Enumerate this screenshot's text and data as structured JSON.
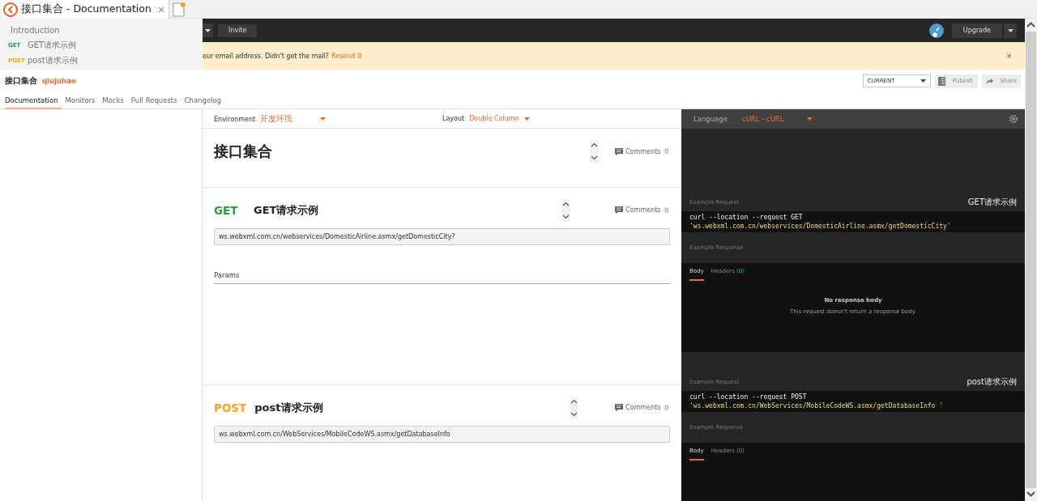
{
  "browser_tab": {
    "title": "接口集合 - Documentation",
    "close": "×"
  },
  "sidebar": {
    "items": [
      {
        "kind": "heading",
        "label": "Introduction"
      },
      {
        "kind": "request",
        "method": "GET",
        "label": "GET请求示例"
      },
      {
        "kind": "request",
        "method": "POST",
        "label": "post请求示例"
      }
    ]
  },
  "app_bar": {
    "invite": "Invite",
    "upgrade": "Upgrade"
  },
  "banner": {
    "text": "our email address. Didn't get the mail?",
    "link": "Resend it",
    "close": "×"
  },
  "collection": {
    "name": "接口集合",
    "owner": "qiujuhao",
    "version": "CURRENT",
    "publish": "Publish",
    "share": "Share"
  },
  "tabs": [
    {
      "label": "Documentation",
      "selected": true
    },
    {
      "label": "Monitors",
      "selected": false
    },
    {
      "label": "Mocks",
      "selected": false
    },
    {
      "label": "Pull Requests",
      "selected": false
    },
    {
      "label": "Changelog",
      "selected": false
    }
  ],
  "environment": {
    "label": "Environment",
    "value": "开发环境"
  },
  "layout": {
    "label": "Layout",
    "value": "Double Column"
  },
  "language": {
    "label": "Language",
    "value": "cURL - cURL"
  },
  "intro": {
    "title": "接口集合",
    "comments": "Comments",
    "count": "0"
  },
  "requests": [
    {
      "method": "GET",
      "name": "GET请求示例",
      "url": "ws.webxml.com.cn/webservices/DomesticAirline.asmx/getDomesticCity?",
      "comments": "Comments",
      "count": "0",
      "params": "Params",
      "example_request_label": "Example Request",
      "example_name": "GET请求示例",
      "curl_command": "curl --location --request GET",
      "curl_url": "'ws.webxml.com.cn/webservices/DomesticAirline.asmx/getDomesticCity'",
      "example_response_label": "Example Response",
      "response_tabs": [
        {
          "label": "Body",
          "selected": true
        },
        {
          "label": "Headers",
          "count": "(0)",
          "selected": false
        }
      ],
      "empty_title": "No response body",
      "empty_text": "This request doesn't return a response body."
    },
    {
      "method": "POST",
      "name": "post请求示例",
      "url": "ws.webxml.com.cn/WebServices/MobileCodeWS.asmx/getDatabaseInfo",
      "comments": "Comments",
      "count": "0",
      "example_request_label": "Example Request",
      "example_name": "post请求示例",
      "curl_command": "curl --location --request POST",
      "curl_url": "'ws.webxml.com.cn/WebServices/MobileCodeWS.asmx/getDatabaseInfo '",
      "example_response_label": "Example Response",
      "response_tabs": [
        {
          "label": "Body",
          "selected": true
        },
        {
          "label": "Headers",
          "count": "(0)",
          "selected": false
        }
      ]
    }
  ]
}
